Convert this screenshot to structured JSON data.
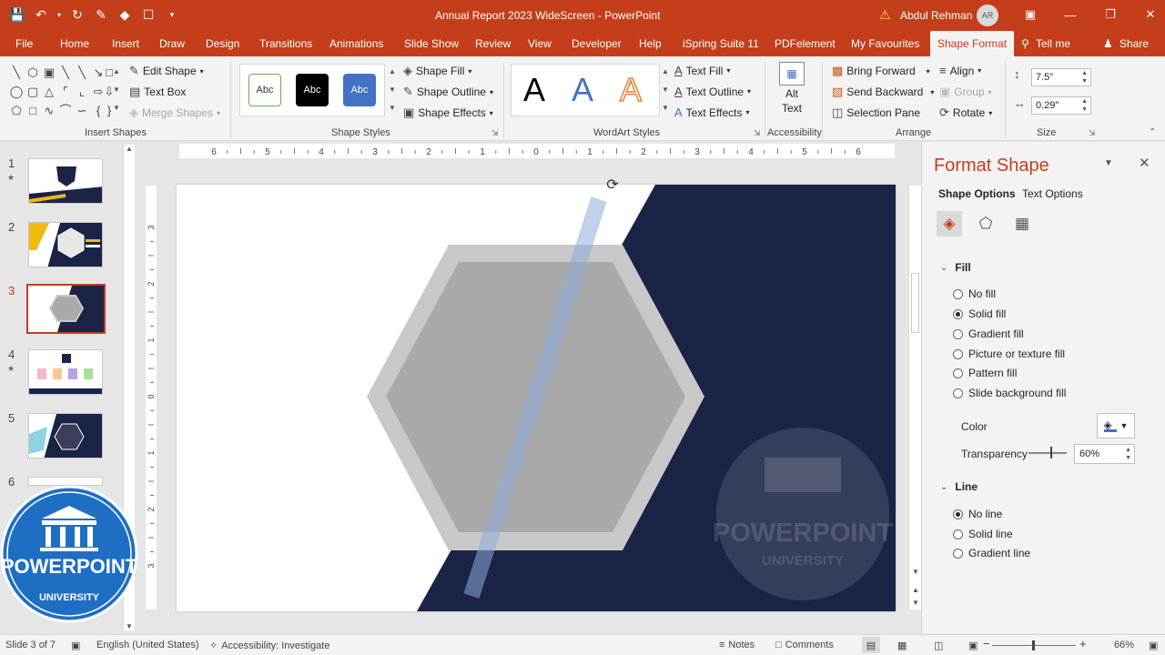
{
  "titlebar": {
    "document_title": "Annual Report 2023 WideScreen  -  PowerPoint",
    "user_name": "Abdul Rehman",
    "user_initials": "AR"
  },
  "tabs": [
    {
      "label": "File"
    },
    {
      "label": "Home"
    },
    {
      "label": "Insert"
    },
    {
      "label": "Draw"
    },
    {
      "label": "Design"
    },
    {
      "label": "Transitions"
    },
    {
      "label": "Animations"
    },
    {
      "label": "Slide Show"
    },
    {
      "label": "Review"
    },
    {
      "label": "View"
    },
    {
      "label": "Developer"
    },
    {
      "label": "Help"
    },
    {
      "label": "iSpring Suite 11"
    },
    {
      "label": "PDFelement"
    },
    {
      "label": "My Favourites"
    },
    {
      "label": "Shape Format"
    },
    {
      "label": "Tell me"
    },
    {
      "label": "Share"
    }
  ],
  "ribbon": {
    "insert_shapes": {
      "label": "Insert Shapes",
      "edit_shape": "Edit Shape",
      "text_box": "Text Box",
      "merge_shapes": "Merge Shapes"
    },
    "shape_styles": {
      "label": "Shape Styles",
      "swatch_text": "Abc",
      "shape_fill": "Shape Fill",
      "shape_outline": "Shape Outline",
      "shape_effects": "Shape Effects"
    },
    "wordart_styles": {
      "label": "WordArt Styles",
      "letter": "A",
      "text_fill": "Text Fill",
      "text_outline": "Text Outline",
      "text_effects": "Text Effects"
    },
    "accessibility": {
      "label": "Accessibility",
      "alt_text_line1": "Alt",
      "alt_text_line2": "Text"
    },
    "arrange": {
      "label": "Arrange",
      "bring_forward": "Bring Forward",
      "send_backward": "Send Backward",
      "selection_pane": "Selection Pane",
      "align": "Align",
      "group": "Group",
      "rotate": "Rotate"
    },
    "size": {
      "label": "Size",
      "height": "7.5\"",
      "width": "0.29\""
    }
  },
  "ruler": {
    "h_ticks": [
      "6",
      "5",
      "4",
      "3",
      "2",
      "1",
      "0",
      "1",
      "2",
      "3",
      "4",
      "5",
      "6"
    ],
    "v_ticks": [
      "3",
      "2",
      "1",
      "0",
      "1",
      "2",
      "3"
    ]
  },
  "slides": [
    {
      "number": "1",
      "star": "★"
    },
    {
      "number": "2",
      "star": ""
    },
    {
      "number": "3",
      "star": ""
    },
    {
      "number": "4",
      "star": "★"
    },
    {
      "number": "5",
      "star": ""
    },
    {
      "number": "6",
      "star": ""
    }
  ],
  "slide_content": {
    "watermark_line1": "POWERPOINT",
    "watermark_line2": "UNIVERSITY"
  },
  "logo": {
    "line1": "POWERPOINT",
    "line2": "UNIVERSITY"
  },
  "format_panel": {
    "title": "Format Shape",
    "tab_shape_options": "Shape Options",
    "tab_text_options": "Text Options",
    "fill": {
      "heading": "Fill",
      "options": [
        {
          "label": "No fill",
          "selected": false
        },
        {
          "label": "Solid fill",
          "selected": true
        },
        {
          "label": "Gradient fill",
          "selected": false
        },
        {
          "label": "Picture or texture fill",
          "selected": false
        },
        {
          "label": "Pattern fill",
          "selected": false
        },
        {
          "label": "Slide background fill",
          "selected": false
        }
      ],
      "color_label": "Color",
      "transparency_label": "Transparency",
      "transparency_value": "60%"
    },
    "line": {
      "heading": "Line",
      "options": [
        {
          "label": "No line",
          "selected": true
        },
        {
          "label": "Solid line",
          "selected": false
        },
        {
          "label": "Gradient line",
          "selected": false
        }
      ]
    }
  },
  "status": {
    "slide_info": "Slide 3 of 7",
    "language": "English (United States)",
    "accessibility": "Accessibility: Investigate",
    "notes": "Notes",
    "comments": "Comments",
    "zoom": "66%"
  },
  "colors": {
    "accent": "#c43e1c",
    "navy": "#1b2447",
    "hexagon_outer": "#c8c8c8",
    "hexagon_inner": "#a9a9a9",
    "selected_bar": "#8ea9db"
  }
}
